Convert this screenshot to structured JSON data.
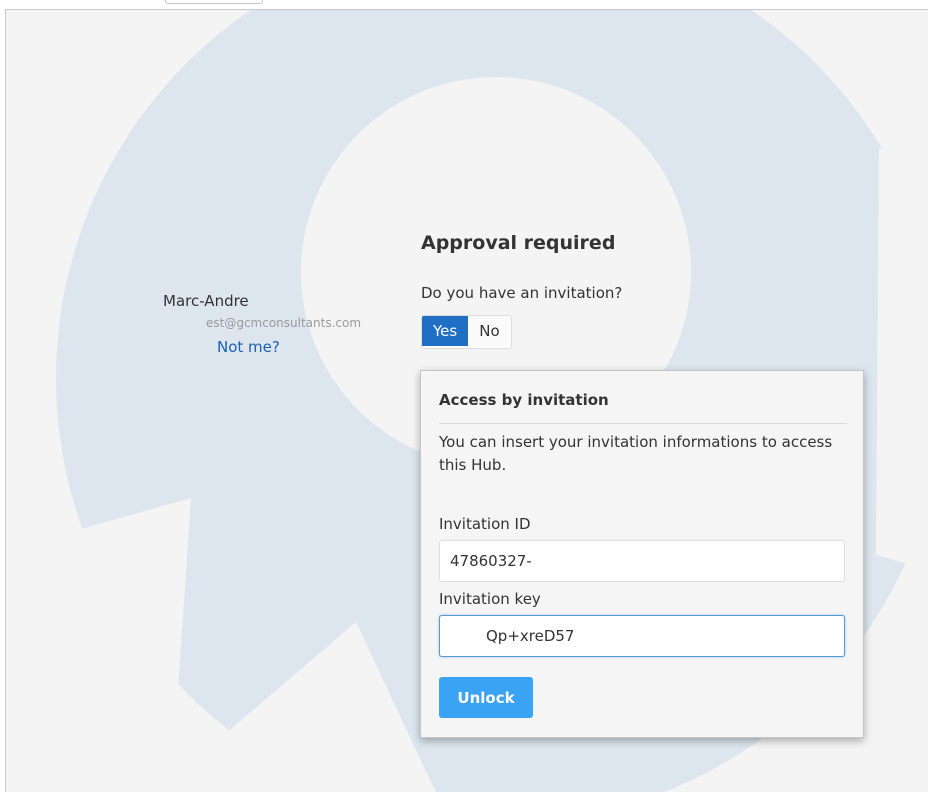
{
  "user": {
    "name": "Marc-Andre",
    "email": "est@gcmconsultants.com",
    "not_me_link": "Not me?"
  },
  "approval": {
    "title": "Approval required",
    "question": "Do you have an invitation?",
    "yes_label": "Yes",
    "no_label": "No",
    "selected": "Yes"
  },
  "invitation": {
    "title": "Access by invitation",
    "description": "You can insert your invitation informations to access this Hub.",
    "id_label": "Invitation ID",
    "id_value": "47860327-",
    "key_label": "Invitation key",
    "key_value": "Qp+xreD57",
    "unlock_label": "Unlock"
  },
  "colors": {
    "accent": "#1f6fc5",
    "unlock": "#3ba3f3",
    "link": "#1c5fb3",
    "background_shape": "#dde6ef",
    "background_light": "#f4f4f4"
  }
}
